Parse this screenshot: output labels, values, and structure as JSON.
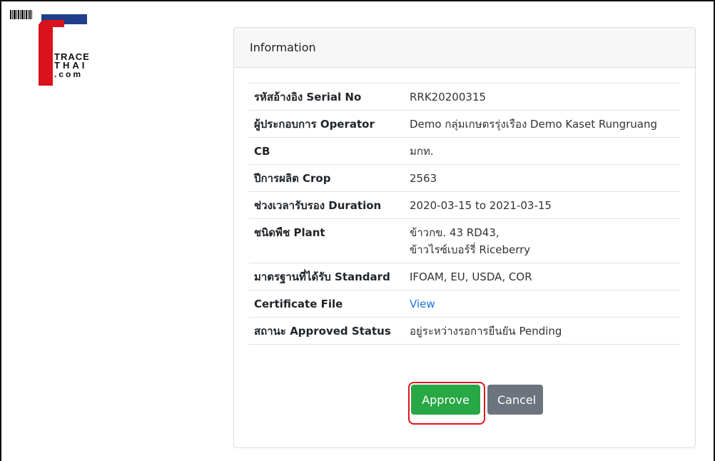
{
  "logo": {
    "line1": "TRACE",
    "line2": "THAI",
    "line3": ".com"
  },
  "card": {
    "header": "Information"
  },
  "rows": [
    {
      "label": "รหัสอ้างอิง Serial No",
      "value": "RRK20200315"
    },
    {
      "label": "ผู้ประกอบการ Operator",
      "value": "Demo กลุ่มเกษตรรุ่งเรือง Demo Kaset Rungruang"
    },
    {
      "label": "CB",
      "value": "มกท."
    },
    {
      "label": "ปีการผลิต Crop",
      "value": "2563"
    },
    {
      "label": "ช่วงเวลารับรอง Duration",
      "value": "2020-03-15 to 2021-03-15"
    },
    {
      "label": "ชนิดพืช Plant",
      "value_lines": [
        "ข้าวกข. 43 RD43,",
        "ข้าวไรซ์เบอร์รี่ Riceberry"
      ]
    },
    {
      "label": "มาตรฐานที่ได้รับ Standard",
      "value": "IFOAM, EU, USDA, COR"
    },
    {
      "label": "Certificate File",
      "link": "View"
    },
    {
      "label": "สถานะ Approved Status",
      "value": "อยู่ระหว่างรอการยืนยัน Pending"
    }
  ],
  "buttons": {
    "approve": "Approve",
    "cancel": "Cancel"
  },
  "colors": {
    "approve": "#28a745",
    "cancel": "#6c757d",
    "highlight": "#e0141c",
    "link": "#1a73e8"
  }
}
